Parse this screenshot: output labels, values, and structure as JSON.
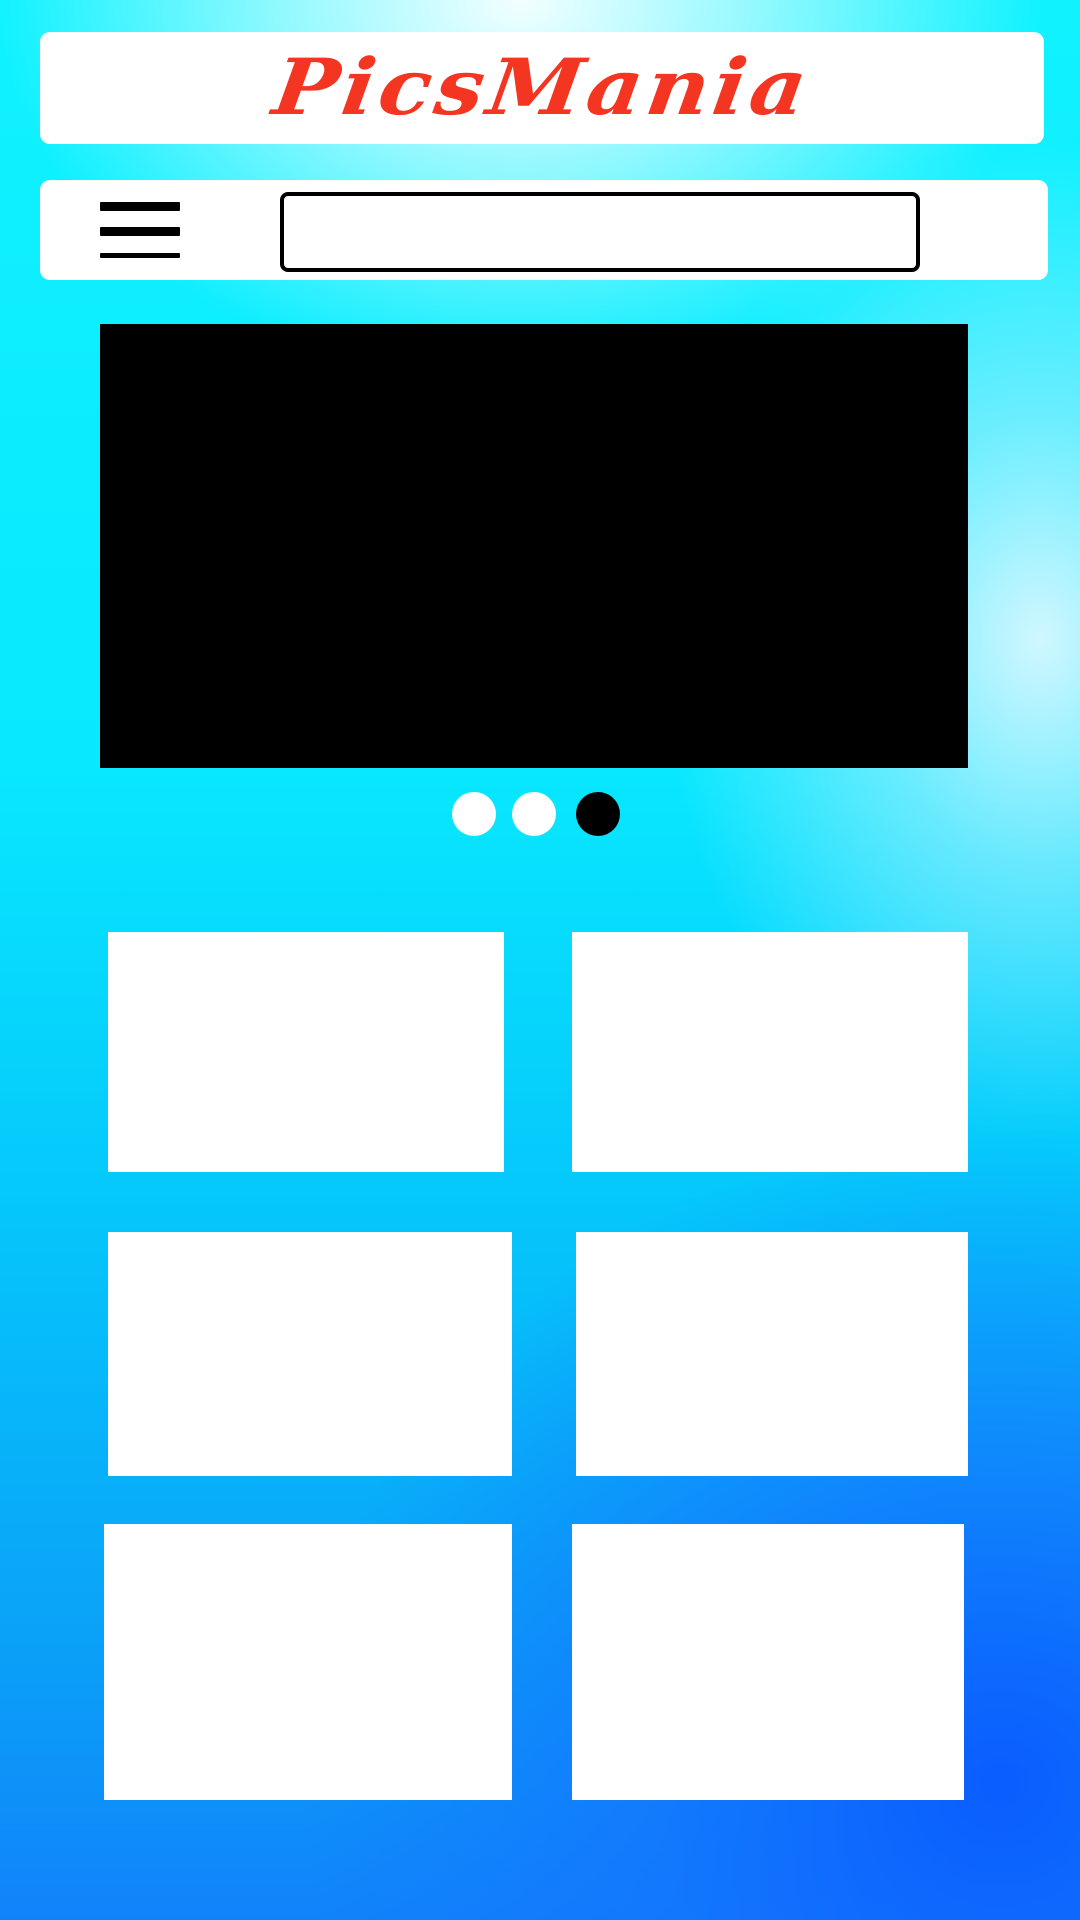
{
  "app": {
    "logo_text": "PicsMania",
    "logo_color": "#f33522"
  },
  "search": {
    "value": "",
    "placeholder": ""
  },
  "slideshow": {
    "background_color": "#000000",
    "dots": [
      {
        "active": false,
        "color": "#ffffff"
      },
      {
        "active": false,
        "color": "#ffffff"
      },
      {
        "active": true,
        "color": "#000000"
      }
    ]
  },
  "gallery": {
    "tile_count": 6,
    "tile_color": "#ffffff"
  },
  "icons": {
    "menu": "hamburger-menu-icon"
  }
}
